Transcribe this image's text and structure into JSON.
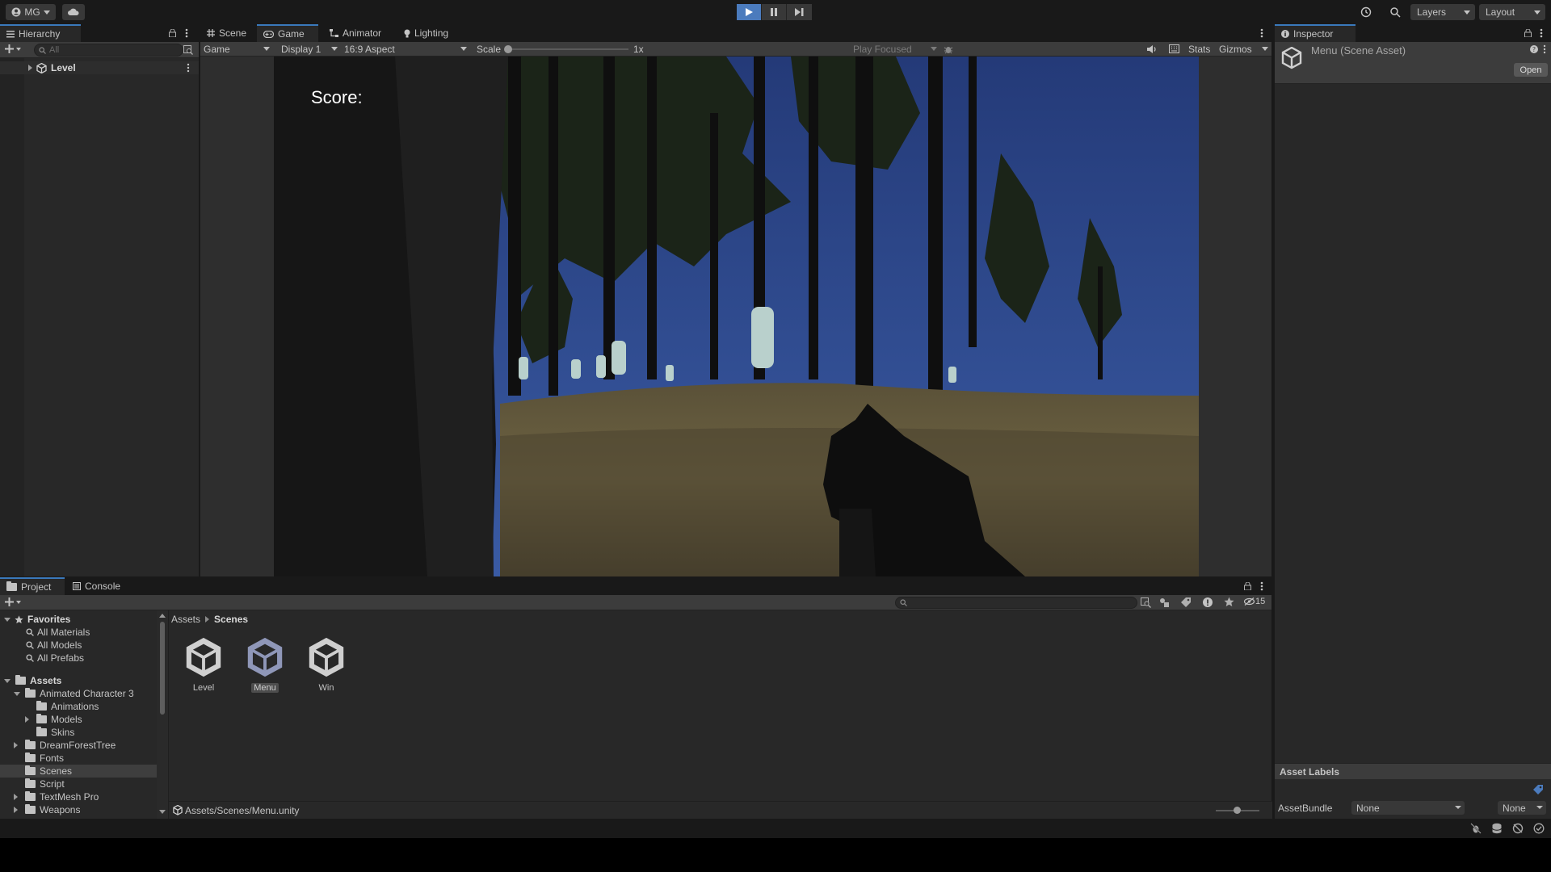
{
  "toolbar": {
    "account": "MG",
    "layers": "Layers",
    "layout": "Layout"
  },
  "hierarchy": {
    "tab": "Hierarchy",
    "search_placeholder": "All",
    "root": "Level"
  },
  "view_tabs": [
    "Scene",
    "Game",
    "Animator",
    "Lighting"
  ],
  "game_toolbar": {
    "mode": "Game",
    "display": "Display 1",
    "aspect": "16:9 Aspect",
    "scale_label": "Scale",
    "scale_value": "1x",
    "play_focused": "Play Focused",
    "stats": "Stats",
    "gizmos": "Gizmos"
  },
  "game_view": {
    "score_label": "Score:"
  },
  "inspector": {
    "tab": "Inspector",
    "title": "Menu (Scene Asset)",
    "open_button": "Open",
    "asset_labels": "Asset Labels",
    "asset_bundle_label": "AssetBundle",
    "asset_bundle_value": "None",
    "asset_variant_value": "None"
  },
  "bottom_tabs": [
    "Project",
    "Console"
  ],
  "project": {
    "favorites_label": "Favorites",
    "favorites": [
      "All Materials",
      "All Models",
      "All Prefabs"
    ],
    "assets_label": "Assets",
    "tree": [
      {
        "label": "Animated Character 3",
        "indent": 1,
        "state": "open"
      },
      {
        "label": "Animations",
        "indent": 2,
        "state": "none"
      },
      {
        "label": "Models",
        "indent": 2,
        "state": "closed"
      },
      {
        "label": "Skins",
        "indent": 2,
        "state": "none"
      },
      {
        "label": "DreamForestTree",
        "indent": 1,
        "state": "closed"
      },
      {
        "label": "Fonts",
        "indent": 1,
        "state": "none"
      },
      {
        "label": "Scenes",
        "indent": 1,
        "state": "none",
        "selected": true
      },
      {
        "label": "Script",
        "indent": 1,
        "state": "none"
      },
      {
        "label": "TextMesh Pro",
        "indent": 1,
        "state": "closed"
      },
      {
        "label": "Weapons",
        "indent": 1,
        "state": "closed"
      }
    ],
    "breadcrumb": [
      "Assets",
      "Scenes"
    ],
    "files": [
      "Level",
      "Menu",
      "Win"
    ],
    "selected_file": "Menu",
    "path": "Assets/Scenes/Menu.unity",
    "hidden_count": "15"
  },
  "colors": {
    "accent": "#4b7bbd",
    "panel": "#282828",
    "sky": "#2e4a8a"
  }
}
